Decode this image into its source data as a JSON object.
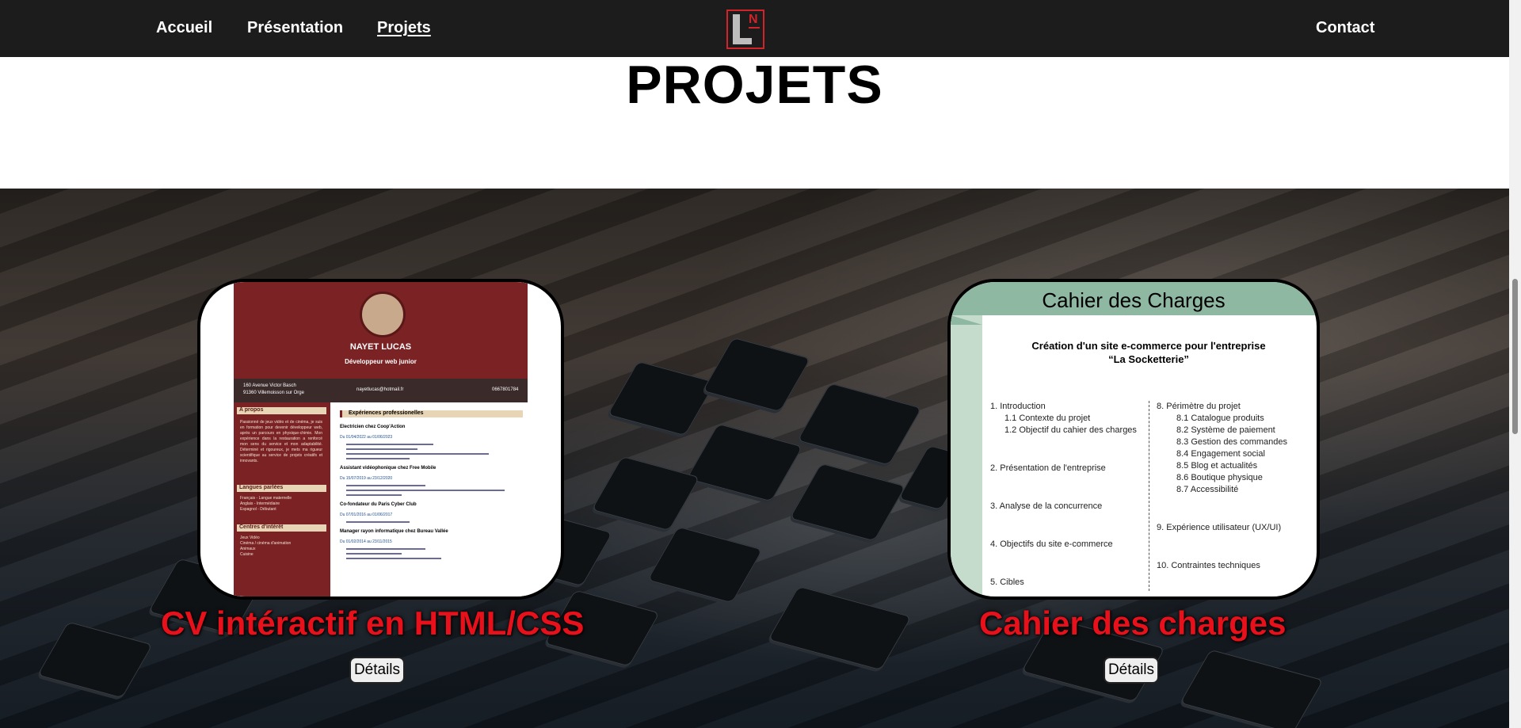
{
  "nav": {
    "items": [
      "Accueil",
      "Présentation",
      "Projets"
    ],
    "contact": "Contact",
    "logo_letter_main": "L",
    "logo_letter_sup": "N"
  },
  "page": {
    "title": "PROJETS"
  },
  "projects": [
    {
      "title": "CV intéractif en HTML/CSS",
      "button": "Détails",
      "preview": {
        "name": "NAYET LUCAS",
        "role": "Développeur web junior",
        "address_l1": "160 Avenue Victor Basch",
        "address_l2": "91360 Villemoisson sur Orge",
        "email": "nayetlucas@hotmail.fr",
        "phone": "0667801784",
        "sections": [
          "A propos",
          "Langues parlées",
          "Centres d'intérêt"
        ],
        "about": "Passionné de jeux vidéo et de cinéma, je suis en formation pour devenir développeur web, après un parcours en physique-chimie. Mon expérience dans la restauration a renforcé mon sens du service et mon adaptabilité. Déterminé et rigoureux, je mets ma rigueur scientifique au service de projets créatifs et innovants.",
        "languages": [
          "Français - Langue maternelle",
          "Anglais - Intermédiaire",
          "Espagnol - Débutant"
        ],
        "interests": [
          "Jeux Vidéo",
          "Cinéma / cinéma d'animation",
          "Animaux",
          "Cuisine"
        ],
        "main_section": "Expériences professionelles",
        "jobs": [
          {
            "title": "Electricien chez Coop'Action",
            "date": "Du 01/04/2022 au 01/06/2023"
          },
          {
            "title": "Assistant vidéophonique chez Free Mobile",
            "date": "Du 15/07/2019 au 23/12/2020"
          },
          {
            "title": "Co-fondateur du Paris Cyber Club",
            "date": "Du 07/01/2016 au 01/06/2017"
          },
          {
            "title": "Manager rayon informatique chez Bureau Vallée",
            "date": "Du 01/02/2014 au 23/11/2015"
          }
        ]
      }
    },
    {
      "title": "Cahier des charges",
      "button": "Détails",
      "preview": {
        "heading": "Cahier des Charges",
        "subtitle_l1": "Création d'un site e-commerce pour  l'entreprise",
        "subtitle_l2": "“La Socketterie”",
        "left": [
          "1. Introduction",
          "1.1 Contexte du projet",
          "1.2 Objectif du cahier des charges",
          "2. Présentation de l'entreprise",
          "3. Analyse de la concurrence",
          "4. Objectifs du site e-commerce",
          "5. Cibles"
        ],
        "right": [
          "8. Périmètre du projet",
          "8.1 Catalogue produits",
          "8.2 Système de paiement",
          "8.3 Gestion des commandes",
          "8.4 Engagement social",
          "8.5 Blog et actualités",
          "8.6 Boutique physique",
          "8.7 Accessibilité",
          "9. Expérience utilisateur (UX/UI)",
          "10. Contraintes techniques"
        ]
      }
    }
  ],
  "colors": {
    "nav_bg": "#1c1c1c",
    "accent_red": "#e8101a",
    "cv_maroon": "#7b2224",
    "cdc_green": "#8fb8a2"
  }
}
